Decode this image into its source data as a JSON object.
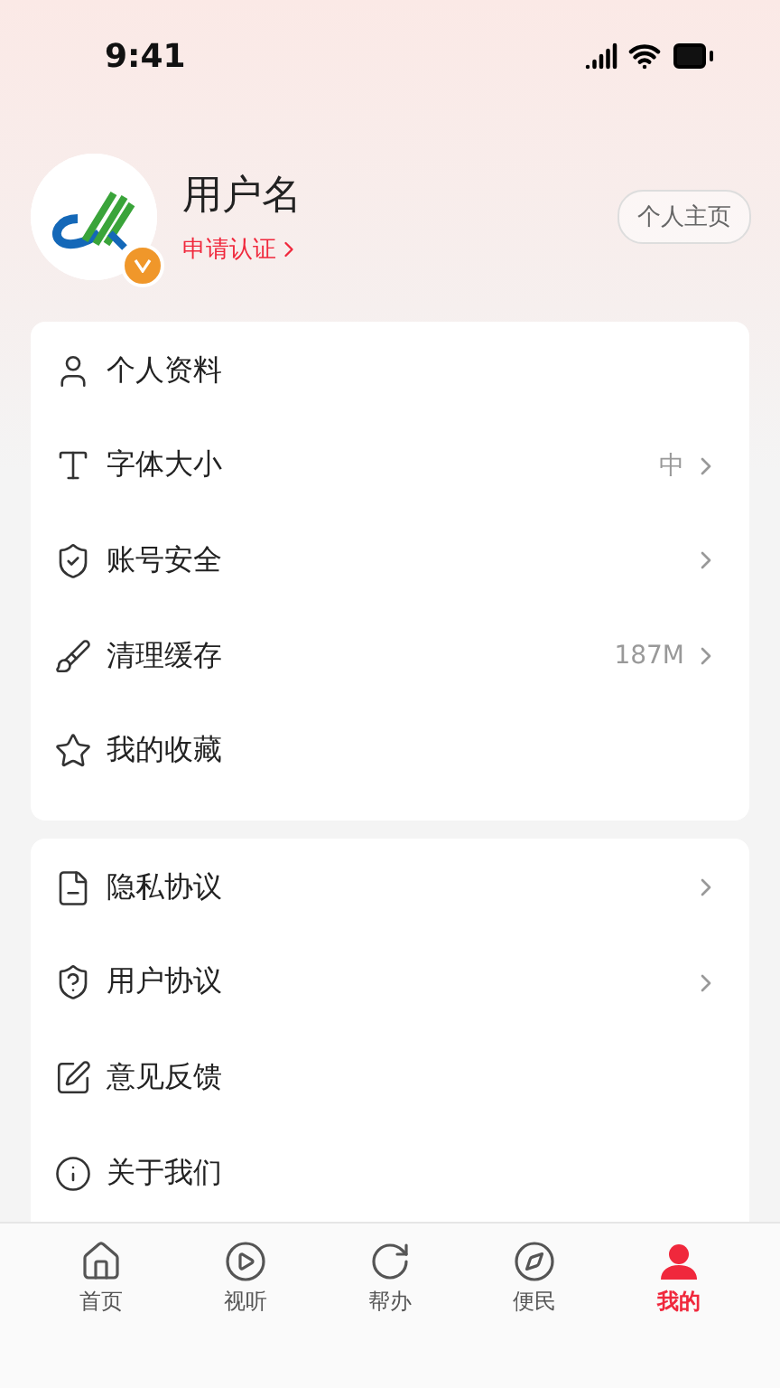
{
  "status_bar": {
    "time": "9:41"
  },
  "profile": {
    "name": "用户名",
    "verify_link": "申请认证",
    "verified": true,
    "homepage_button": "个人主页"
  },
  "menu_groups": [
    {
      "items": [
        {
          "label": "个人资料",
          "value": "",
          "chevron": false
        },
        {
          "label": "字体大小",
          "value": "中",
          "chevron": true
        },
        {
          "label": "账号安全",
          "chevron": true
        },
        {
          "label": "清理缓存",
          "value": "187M",
          "chevron": true
        },
        {
          "label": "我的收藏",
          "chevron": false
        }
      ]
    },
    {
      "items": [
        {
          "label": "隐私协议",
          "chevron": true
        },
        {
          "label": "用户协议",
          "chevron": true
        },
        {
          "label": "意见反馈",
          "chevron": false
        },
        {
          "label": "关于我们",
          "chevron": false
        }
      ]
    }
  ],
  "tab_bar": [
    {
      "label": "首页",
      "selected": false
    },
    {
      "label": "视听",
      "selected": false
    },
    {
      "label": "帮办",
      "selected": false
    },
    {
      "label": "便民",
      "selected": false
    },
    {
      "label": "我的",
      "selected": true
    }
  ]
}
